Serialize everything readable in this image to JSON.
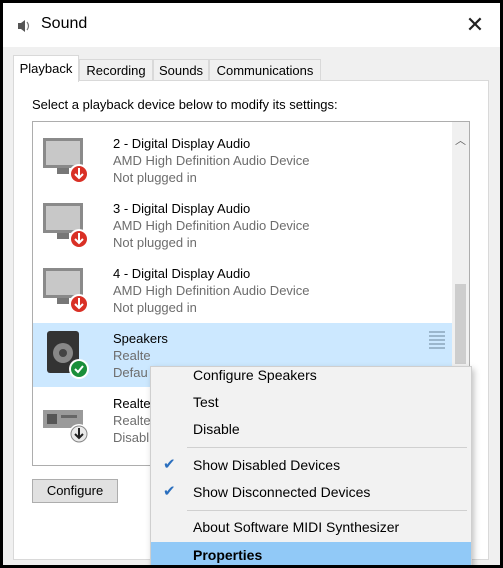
{
  "window": {
    "title": "Sound",
    "close_glyph": "✕"
  },
  "tabs": [
    {
      "label": "Playback",
      "active": true
    },
    {
      "label": "Recording",
      "active": false
    },
    {
      "label": "Sounds",
      "active": false
    },
    {
      "label": "Communications",
      "active": false
    }
  ],
  "instructions": "Select a playback device below to modify its settings:",
  "devices": [
    {
      "name": "2 - Digital Display Audio",
      "driver": "AMD High Definition Audio Device",
      "status": "Not plugged in",
      "icon": "monitor-unplugged-icon"
    },
    {
      "name": "3 - Digital Display Audio",
      "driver": "AMD High Definition Audio Device",
      "status": "Not plugged in",
      "icon": "monitor-unplugged-icon"
    },
    {
      "name": "4 - Digital Display Audio",
      "driver": "AMD High Definition Audio Device",
      "status": "Not plugged in",
      "icon": "monitor-unplugged-icon"
    },
    {
      "name": "Speakers",
      "driver": "Realte",
      "status": "Defau",
      "icon": "speaker-default-icon",
      "selected": true
    },
    {
      "name": "Realte",
      "driver": "Realte",
      "status": "Disabl",
      "icon": "digital-output-icon"
    }
  ],
  "buttons": {
    "configure": "Configure"
  },
  "context_menu": {
    "items": [
      {
        "label": "Configure Speakers",
        "checked": false
      },
      {
        "label": "Test",
        "checked": false
      },
      {
        "label": "Disable",
        "checked": false
      },
      {
        "label": "Show Disabled Devices",
        "checked": true
      },
      {
        "label": "Show Disconnected Devices",
        "checked": true
      },
      {
        "label": "About Software MIDI Synthesizer",
        "checked": false
      },
      {
        "label": "Properties",
        "checked": false,
        "highlighted": true
      }
    ],
    "check_glyph": "✔"
  },
  "colors": {
    "selection": "#cce8ff",
    "menu_highlight": "#91c9f7",
    "check": "#2b6fbe"
  }
}
